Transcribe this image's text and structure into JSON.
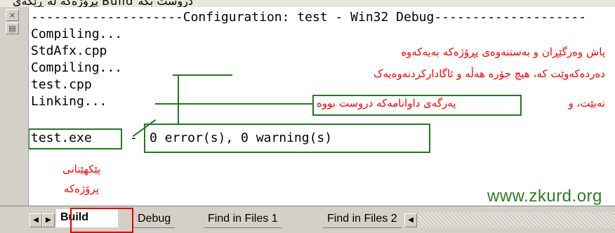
{
  "top_strip": {
    "clipped_text": "پڕۆژەکە لە ڕێگەی Build دروست بکە"
  },
  "gutter": {
    "close_glyph": "×",
    "pin_glyph": "▤"
  },
  "output": {
    "lines": [
      "--------------------Configuration: test - Win32 Debug--------------------",
      "Compiling...",
      "StdAfx.cpp",
      "Compiling...",
      "test.cpp",
      "Linking...",
      "",
      "test.exe - 0 error(s), 0 warning(s)"
    ],
    "exe_name": "test.exe",
    "dash": "-",
    "result": "0 error(s), 0 warning(s)"
  },
  "annotations": {
    "line1": "پاش وەرگێڕان و بەستنەوەی پڕۆژەکە بەیەکەوە",
    "line2": "دەردەکەوێت کە، هیچ جۆرە هەڵە و ئاگادارکردنەوەیەک",
    "line3_prefix": "نەبێت، و",
    "line3_boxed": "پەرگەی داوانامەکە دروست بووە",
    "exe_label_1": "پێکهێنانی",
    "exe_label_2": "پرۆژەکە"
  },
  "watermark": "www.zkurd.org",
  "tabs": {
    "nav_left": "◀",
    "nav_right": "▶",
    "items": [
      "Build",
      "Debug",
      "Find in Files 1",
      "Find in Files 2"
    ],
    "scroll_left": "◀"
  },
  "colors": {
    "annotation": "#ff0000",
    "box": "#1f7a1f",
    "tab_highlight": "#e00000",
    "watermark": "#2e7d1e"
  }
}
